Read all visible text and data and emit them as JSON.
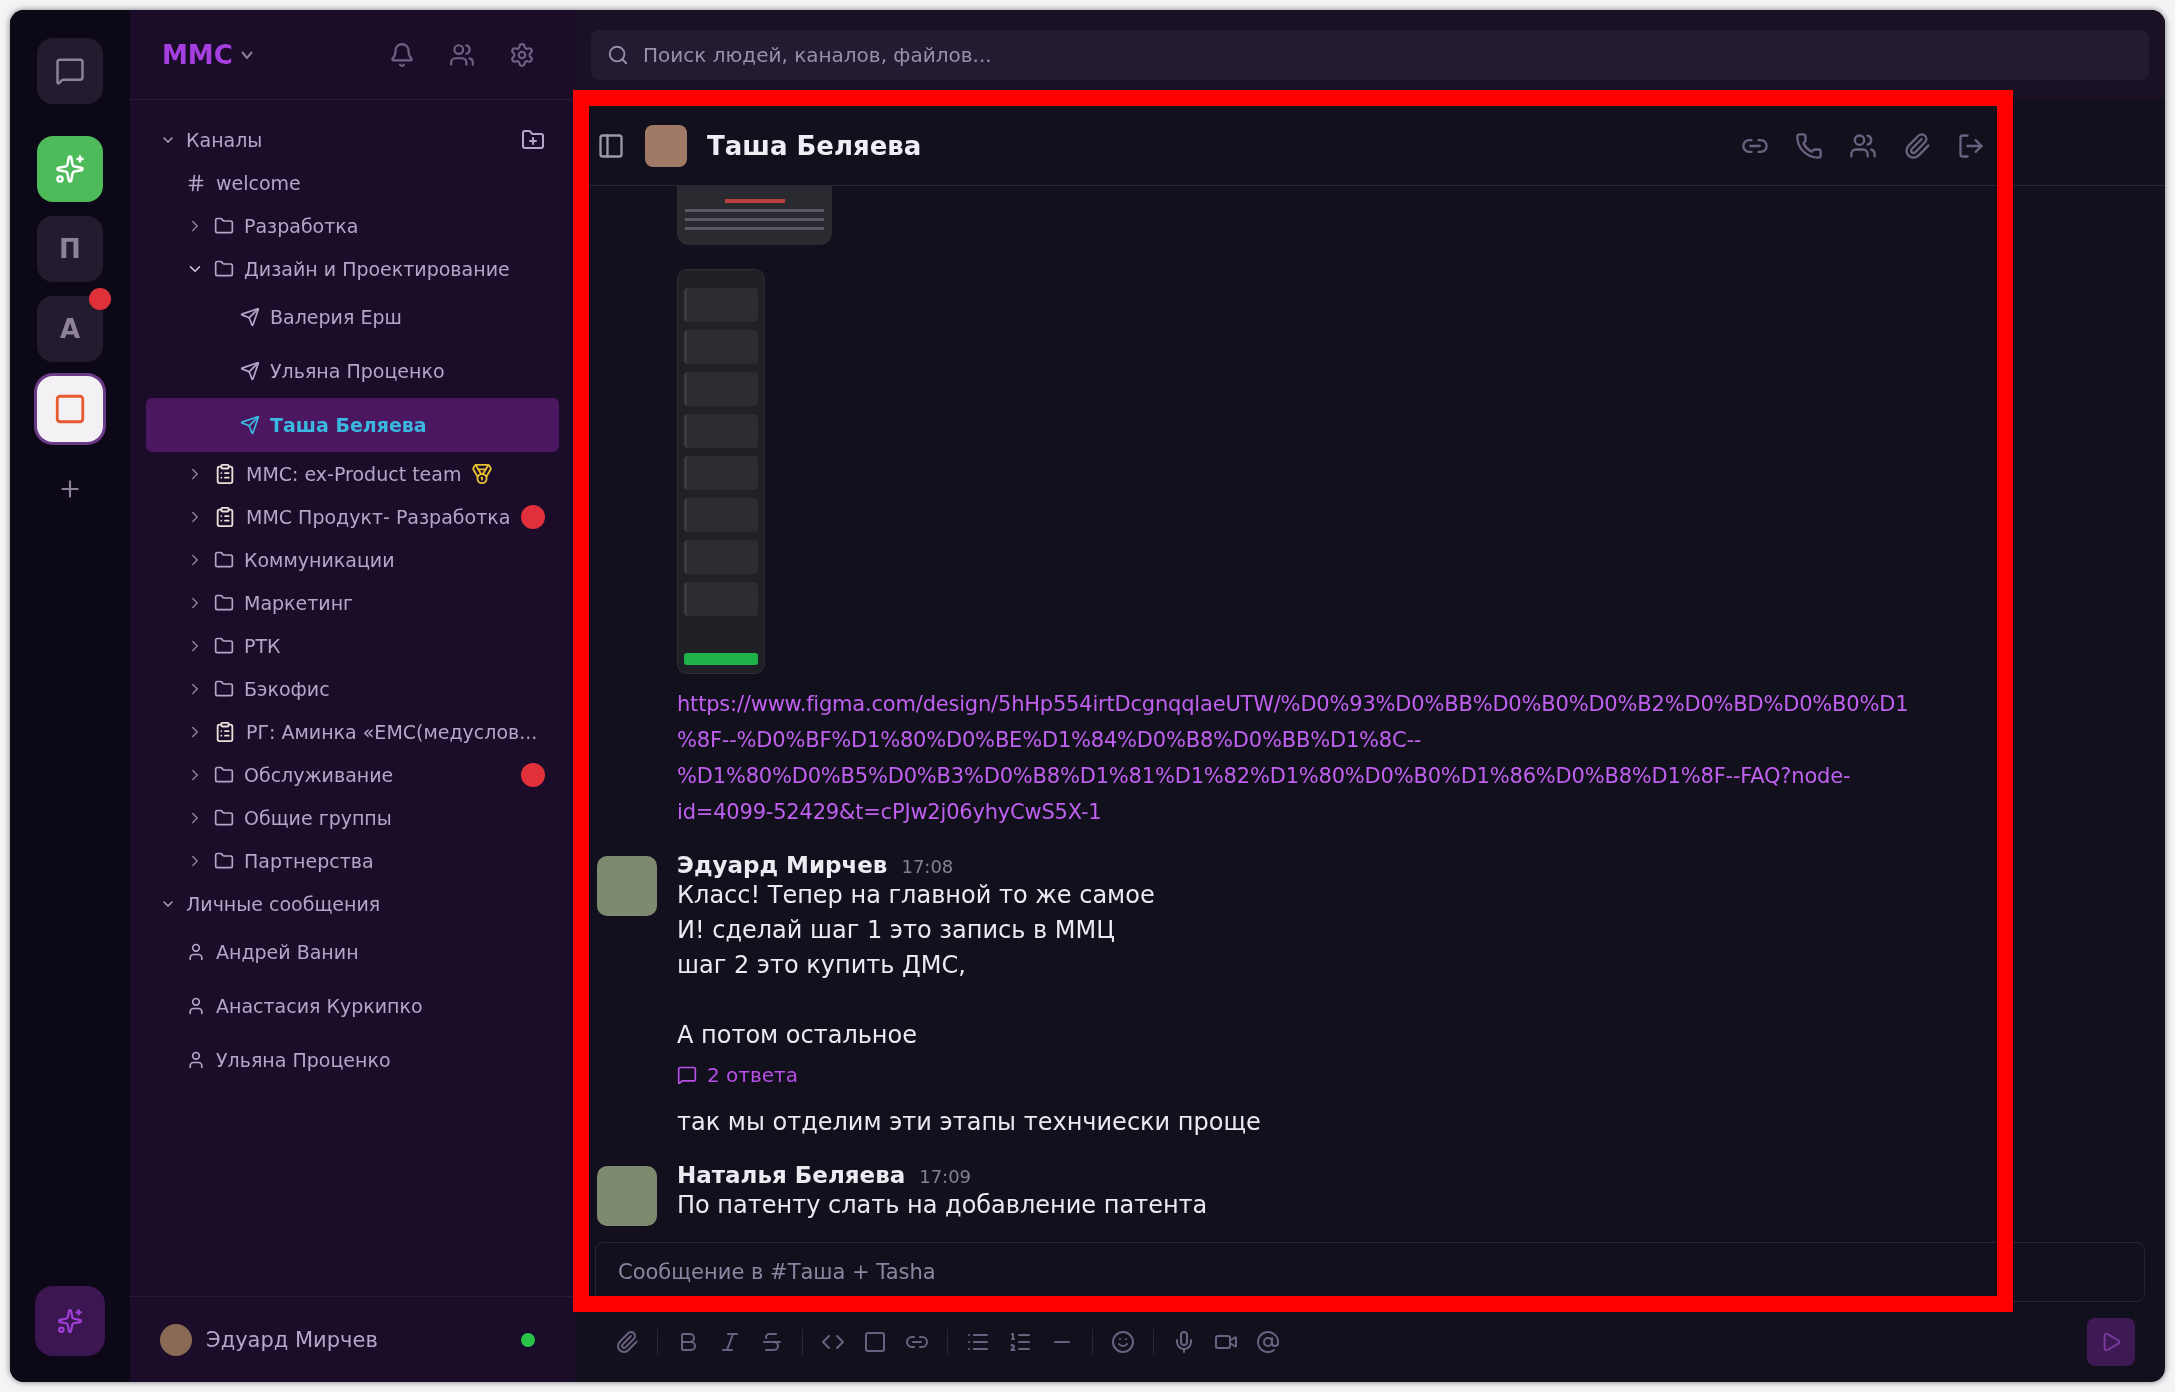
{
  "workspace": {
    "name": "ММС"
  },
  "rail": [
    {
      "kind": "chat",
      "selected": false,
      "badge": false
    },
    {
      "kind": "app-green",
      "selected": false,
      "badge": false
    },
    {
      "kind": "letter",
      "letter": "П",
      "selected": false,
      "badge": false
    },
    {
      "kind": "letter",
      "letter": "А",
      "selected": false,
      "badge": true
    },
    {
      "kind": "app-color",
      "selected": true,
      "badge": false
    },
    {
      "kind": "add",
      "selected": false,
      "badge": false
    }
  ],
  "search": {
    "placeholder": "Поиск людей, каналов, файлов..."
  },
  "sidebar": {
    "sections": [
      {
        "title": "Каналы",
        "expanded": true,
        "children": [
          {
            "kind": "channel",
            "label": "welcome",
            "selected": false,
            "badge": false
          },
          {
            "kind": "folder",
            "label": "Разработка",
            "expanded": false,
            "selected": false,
            "badge": false
          },
          {
            "kind": "folder",
            "label": "Дизайн и Проектирование",
            "expanded": true,
            "selected": false,
            "badge": false,
            "children": [
              {
                "kind": "thread",
                "label": "Валерия Ерш",
                "selected": false,
                "badge": false
              },
              {
                "kind": "thread",
                "label": "Ульяна Проценко",
                "selected": false,
                "badge": false
              },
              {
                "kind": "thread",
                "label": "Таша Беляева",
                "selected": true,
                "badge": false
              }
            ]
          },
          {
            "kind": "board",
            "label": "ММС: ex-Product team",
            "medal": true,
            "expanded": false,
            "selected": false,
            "badge": false
          },
          {
            "kind": "board",
            "label": "ММС Продукт- Разработка",
            "expanded": false,
            "selected": false,
            "badge": true
          },
          {
            "kind": "folder",
            "label": "Коммуникации",
            "expanded": false,
            "selected": false,
            "badge": false
          },
          {
            "kind": "folder",
            "label": "Маркетинг",
            "expanded": false,
            "selected": false,
            "badge": false
          },
          {
            "kind": "folder",
            "label": "РТК",
            "expanded": false,
            "selected": false,
            "badge": false
          },
          {
            "kind": "folder",
            "label": "Бэкофис",
            "expanded": false,
            "selected": false,
            "badge": false
          },
          {
            "kind": "board",
            "label": "РГ: Аминка «EMC(медуслов...",
            "expanded": false,
            "selected": false,
            "badge": false
          },
          {
            "kind": "folder",
            "label": "Обслуживание",
            "expanded": false,
            "selected": false,
            "badge": true
          },
          {
            "kind": "folder",
            "label": "Общие группы",
            "expanded": false,
            "selected": false,
            "badge": false
          },
          {
            "kind": "folder",
            "label": "Партнерства",
            "expanded": false,
            "selected": false,
            "badge": false
          }
        ]
      },
      {
        "title": "Личные сообщения",
        "expanded": true,
        "children": [
          {
            "kind": "dm",
            "label": "Андрей Ванин",
            "selected": false,
            "badge": false
          },
          {
            "kind": "dm",
            "label": "Анастасия Куркипко",
            "selected": false,
            "badge": false
          },
          {
            "kind": "dm",
            "label": "Ульяна Проценко",
            "selected": false,
            "badge": false
          }
        ]
      }
    ],
    "user": {
      "name": "Эдуард Мирчев",
      "online": true
    }
  },
  "chat": {
    "title": "Таша Беляева",
    "messages": [
      {
        "kind": "preview"
      },
      {
        "kind": "screenshot"
      },
      {
        "kind": "link",
        "lines": [
          "https://www.figma.com/design/5hHp554irtDcgnqqlaeUTW/%D0%93%D0%BB%D0%B0%D0%B2%D0%BD%D0%B0%D1",
          "%8F--%D0%BF%D1%80%D0%BE%D1%84%D0%B8%D0%BB%D1%8C--",
          "%D1%80%D0%B5%D0%B3%D0%B8%D1%81%D1%82%D1%80%D0%B0%D1%86%D0%B8%D1%8F--FAQ?node-",
          "id=4099-52429&t=cPJw2j06yhyCwS5X-1"
        ]
      },
      {
        "kind": "post",
        "author": "Эдуард Мирчев",
        "time": "17:08",
        "text": "Класс! Тепер на главной то же самое\nИ! сделай шаг 1 это запись в ММЦ\nшаг 2 это купить ДМС,\n\nА потом остальное",
        "replies": "2 ответа"
      },
      {
        "kind": "text",
        "text": "так мы отделим эти этапы технчиески проще"
      },
      {
        "kind": "post",
        "author": "Наталья Беляева",
        "time": "17:09",
        "text": "По патенту слать на добавление патента"
      }
    ],
    "composer": {
      "placeholder": "Сообщение в #Таша + Tasha"
    }
  },
  "highlight": {
    "shown": true
  }
}
